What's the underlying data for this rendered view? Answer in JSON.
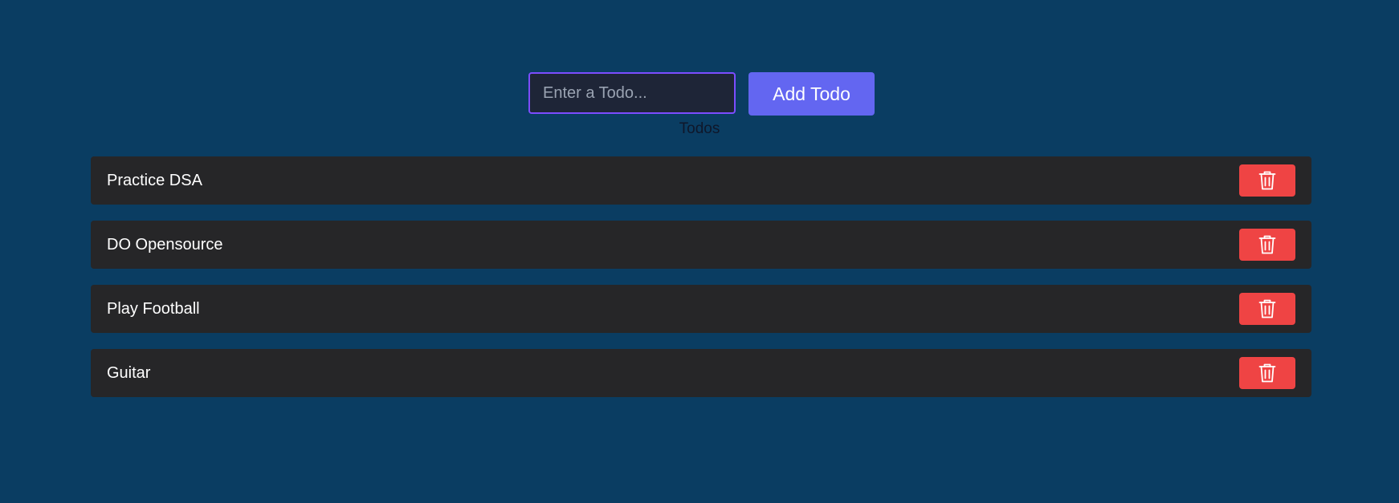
{
  "form": {
    "input_placeholder": "Enter a Todo...",
    "input_value": "",
    "add_button_label": "Add Todo"
  },
  "section_label": "Todos",
  "todos": [
    {
      "text": "Practice DSA"
    },
    {
      "text": "DO Opensource"
    },
    {
      "text": "Play Football"
    },
    {
      "text": "Guitar"
    }
  ],
  "colors": {
    "page_background": "#0a3d62",
    "input_border": "#7c4dff",
    "add_button": "#6366f1",
    "todo_background": "#262628",
    "delete_button": "#ef4444"
  },
  "icons": {
    "delete": "trash-icon"
  }
}
